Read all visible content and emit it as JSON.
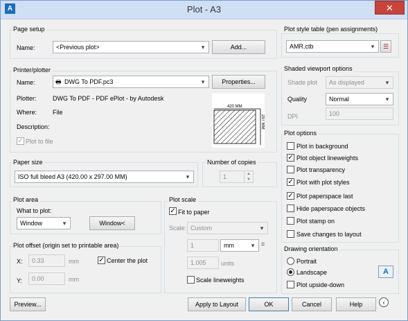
{
  "window": {
    "title": "Plot - A3",
    "close_glyph": "✕",
    "app_icon_letter": "A"
  },
  "page_setup": {
    "group_label": "Page setup",
    "name_label": "Name:",
    "name_value": "<Previous plot>",
    "add_button": "Add..."
  },
  "printer": {
    "group_label": "Printer/plotter",
    "name_label": "Name:",
    "name_value": "DWG To PDF.pc3",
    "properties_button": "Properties...",
    "plotter_label": "Plotter:",
    "plotter_value": "DWG To PDF - PDF ePlot - by Autodesk",
    "where_label": "Where:",
    "where_value": "File",
    "description_label": "Description:",
    "plot_to_file_label": "Plot to file",
    "plot_to_file_checked": true,
    "preview_width_label": "420  MM",
    "preview_height_label": "297  MM"
  },
  "paper_size": {
    "group_label": "Paper size",
    "value": "ISO full bleed A3 (420.00 x 297.00 MM)"
  },
  "copies": {
    "group_label": "Number of copies",
    "value": "1"
  },
  "plot_area": {
    "group_label": "Plot area",
    "what_label": "What to plot:",
    "what_value": "Window",
    "window_button": "Window<"
  },
  "plot_offset": {
    "group_label": "Plot offset (origin set to printable area)",
    "x_label": "X:",
    "x_value": "0.33",
    "x_unit": "mm",
    "y_label": "Y:",
    "y_value": "0.00",
    "y_unit": "mm",
    "center_label": "Center the plot",
    "center_checked": true
  },
  "plot_scale": {
    "group_label": "Plot scale",
    "fit_label": "Fit to paper",
    "fit_checked": true,
    "scale_label": "Scale:",
    "scale_value": "Custom",
    "value1": "1",
    "unit1": "mm",
    "equals": "=",
    "value2": "1.005",
    "unit2": "units",
    "lineweights_label": "Scale lineweights",
    "lineweights_checked": false
  },
  "plot_style": {
    "group_label": "Plot style table (pen assignments)",
    "value": "AMR.ctb"
  },
  "shaded": {
    "group_label": "Shaded viewport options",
    "shade_label": "Shade plot",
    "shade_value": "As displayed",
    "quality_label": "Quality",
    "quality_value": "Normal",
    "dpi_label": "DPI",
    "dpi_value": "100"
  },
  "plot_options": {
    "group_label": "Plot options",
    "items": [
      {
        "label": "Plot in background",
        "checked": false
      },
      {
        "label": "Plot object lineweights",
        "checked": true
      },
      {
        "label": "Plot transparency",
        "checked": false
      },
      {
        "label": "Plot with plot styles",
        "checked": true
      },
      {
        "label": "Plot paperspace last",
        "checked": true
      },
      {
        "label": "Hide paperspace objects",
        "checked": false
      },
      {
        "label": "Plot stamp on",
        "checked": false
      },
      {
        "label": "Save changes to layout",
        "checked": false
      }
    ]
  },
  "orientation": {
    "group_label": "Drawing orientation",
    "portrait_label": "Portrait",
    "landscape_label": "Landscape",
    "selected": "Landscape",
    "upside_down_label": "Plot upside-down",
    "upside_down_checked": false,
    "orientation_icon_letter": "A"
  },
  "buttons": {
    "preview": "Preview...",
    "apply": "Apply to Layout",
    "ok": "OK",
    "cancel": "Cancel",
    "help": "Help",
    "collapse_glyph": "‹"
  },
  "colors": {
    "titlebar": "#cfe0f5",
    "close": "#c7443b",
    "accent": "#1a6fb8"
  }
}
